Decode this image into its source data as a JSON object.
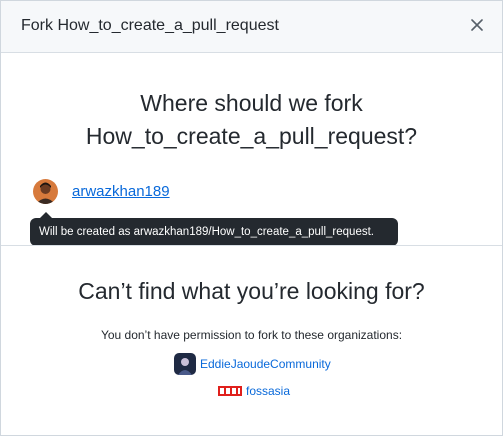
{
  "dialog": {
    "title": "Fork How_to_create_a_pull_request",
    "close_icon": "close-icon"
  },
  "main": {
    "question_line1": "Where should we fork",
    "question_line2": "How_to_create_a_pull_request?",
    "owner": {
      "username": "arwazkhan189",
      "avatar_icon": "user-avatar"
    },
    "tooltip": "Will be created as arwazkhan189/How_to_create_a_pull_request."
  },
  "other": {
    "heading": "Can’t find what you’re looking for?",
    "permission_note": "You don’t have permission to fork to these organizations:",
    "organizations": [
      {
        "name": "EddieJaoudeCommunity",
        "icon": "org-avatar-eddiejaoude"
      },
      {
        "name": "fossasia",
        "icon": "org-logo-fossasia"
      }
    ]
  },
  "colors": {
    "link": "#0969da",
    "text": "#24292f",
    "header_bg": "#f6f8fa",
    "tooltip_bg": "#24292f",
    "fossasia_red": "#e0201c"
  }
}
